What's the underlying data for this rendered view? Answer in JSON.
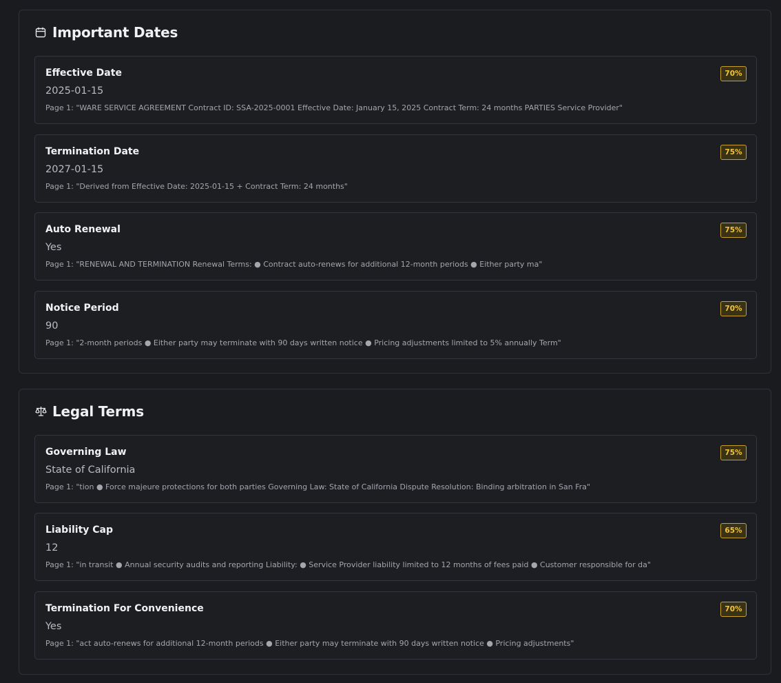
{
  "sections": [
    {
      "title": "Important Dates",
      "icon": "calendar-icon",
      "cards": [
        {
          "title": "Effective Date",
          "value": "2025-01-15",
          "source": "Page 1: \"WARE SERVICE AGREEMENT Contract ID: SSA-2025-0001 Effective Date: January 15, 2025 Contract Term: 24 months PARTIES Service Provider\"",
          "confidence": "70%"
        },
        {
          "title": "Termination Date",
          "value": "2027-01-15",
          "source": "Page 1: \"Derived from Effective Date: 2025-01-15 + Contract Term: 24 months\"",
          "confidence": "75%"
        },
        {
          "title": "Auto Renewal",
          "value": "Yes",
          "source": "Page 1: \"RENEWAL AND TERMINATION Renewal Terms: ● Contract auto-renews for additional 12-month periods ● Either party ma\"",
          "confidence": "75%"
        },
        {
          "title": "Notice Period",
          "value": "90",
          "source": "Page 1: \"2-month periods ● Either party may terminate with 90 days written notice ● Pricing adjustments limited to 5% annually Term\"",
          "confidence": "70%"
        }
      ]
    },
    {
      "title": "Legal Terms",
      "icon": "scales-icon",
      "cards": [
        {
          "title": "Governing Law",
          "value": "State of California",
          "source": "Page 1: \"tion ● Force majeure protections for both parties Governing Law: State of California Dispute Resolution: Binding arbitration in San Fra\"",
          "confidence": "75%"
        },
        {
          "title": "Liability Cap",
          "value": "12",
          "source": "Page 1: \"in transit ● Annual security audits and reporting Liability: ● Service Provider liability limited to 12 months of fees paid ● Customer responsible for da\"",
          "confidence": "65%"
        },
        {
          "title": "Termination For Convenience",
          "value": "Yes",
          "source": "Page 1: \"act auto-renews for additional 12-month periods ● Either party may terminate with 90 days written notice ● Pricing adjustments\"",
          "confidence": "70%"
        }
      ]
    }
  ],
  "colors": {
    "background": "#1a1b1e",
    "badge_text": "#f3c53c",
    "badge_border": "#c8a02a"
  }
}
